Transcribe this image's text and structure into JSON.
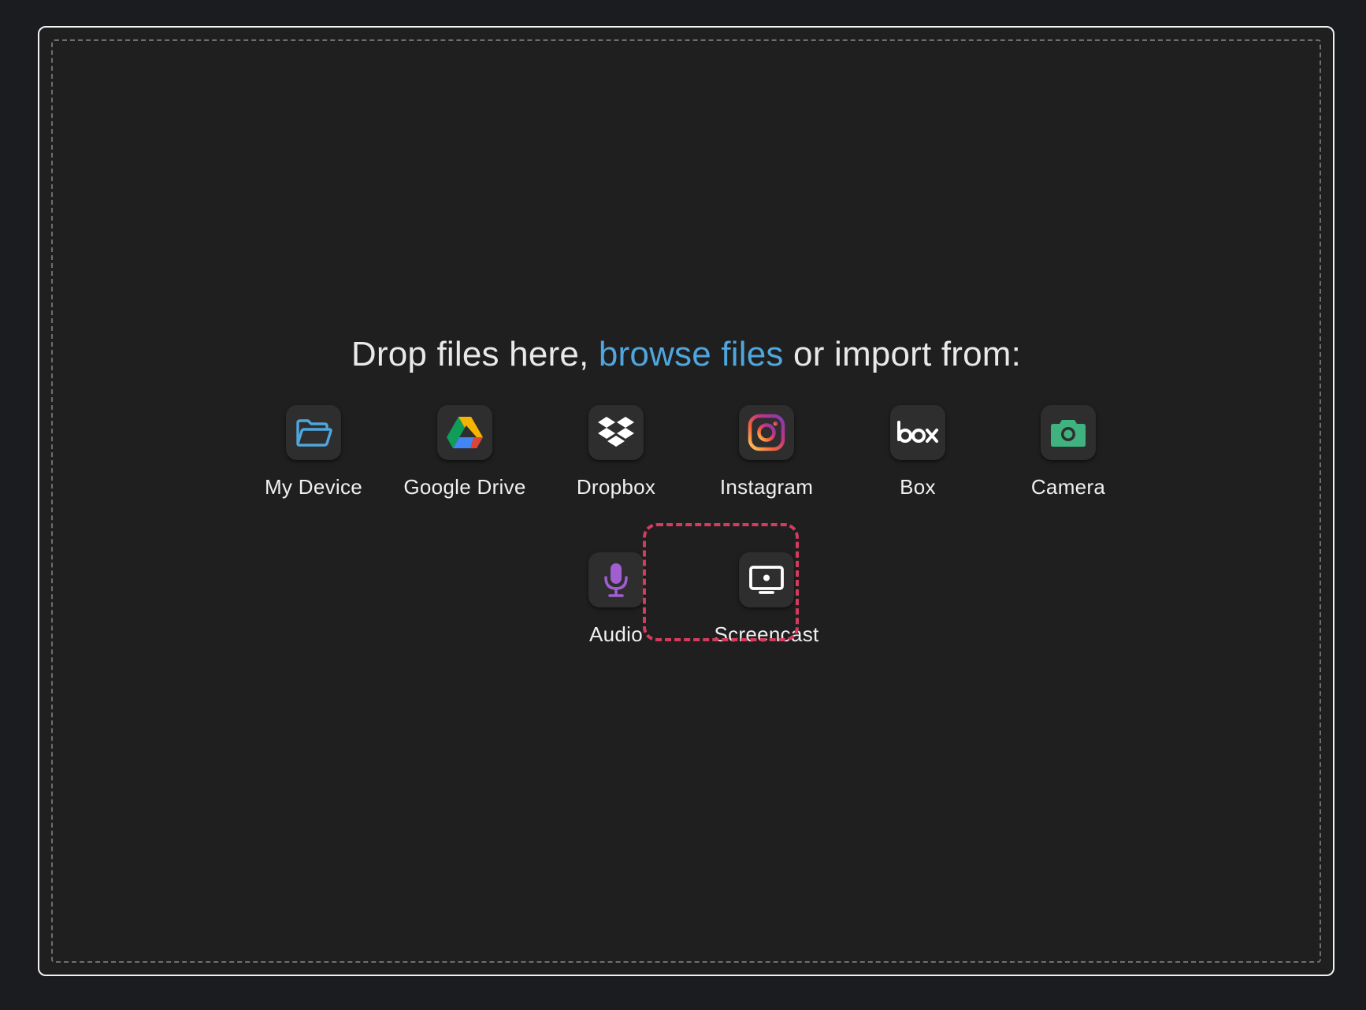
{
  "dropzone": {
    "prefix": "Drop files here, ",
    "browse_link": "browse files",
    "suffix": " or import from:"
  },
  "sources": [
    {
      "id": "my-device",
      "label": "My Device",
      "icon": "folder-icon",
      "color": "#4fa6dd"
    },
    {
      "id": "google-drive",
      "label": "Google Drive",
      "icon": "google-drive-icon"
    },
    {
      "id": "dropbox",
      "label": "Dropbox",
      "icon": "dropbox-icon",
      "color": "#ffffff"
    },
    {
      "id": "instagram",
      "label": "Instagram",
      "icon": "instagram-icon"
    },
    {
      "id": "box",
      "label": "Box",
      "icon": "box-icon",
      "color": "#ffffff"
    },
    {
      "id": "camera",
      "label": "Camera",
      "icon": "camera-icon",
      "color": "#3fb27f"
    },
    {
      "id": "audio",
      "label": "Audio",
      "icon": "microphone-icon",
      "color": "#a15ed0"
    },
    {
      "id": "screencast",
      "label": "Screencast",
      "icon": "screen-icon",
      "color": "#ffffff",
      "highlighted": true
    }
  ],
  "colors": {
    "background": "#1b1c20",
    "panel": "#1f1f1f",
    "link": "#4fa6dd",
    "highlight": "#d33b5f"
  }
}
